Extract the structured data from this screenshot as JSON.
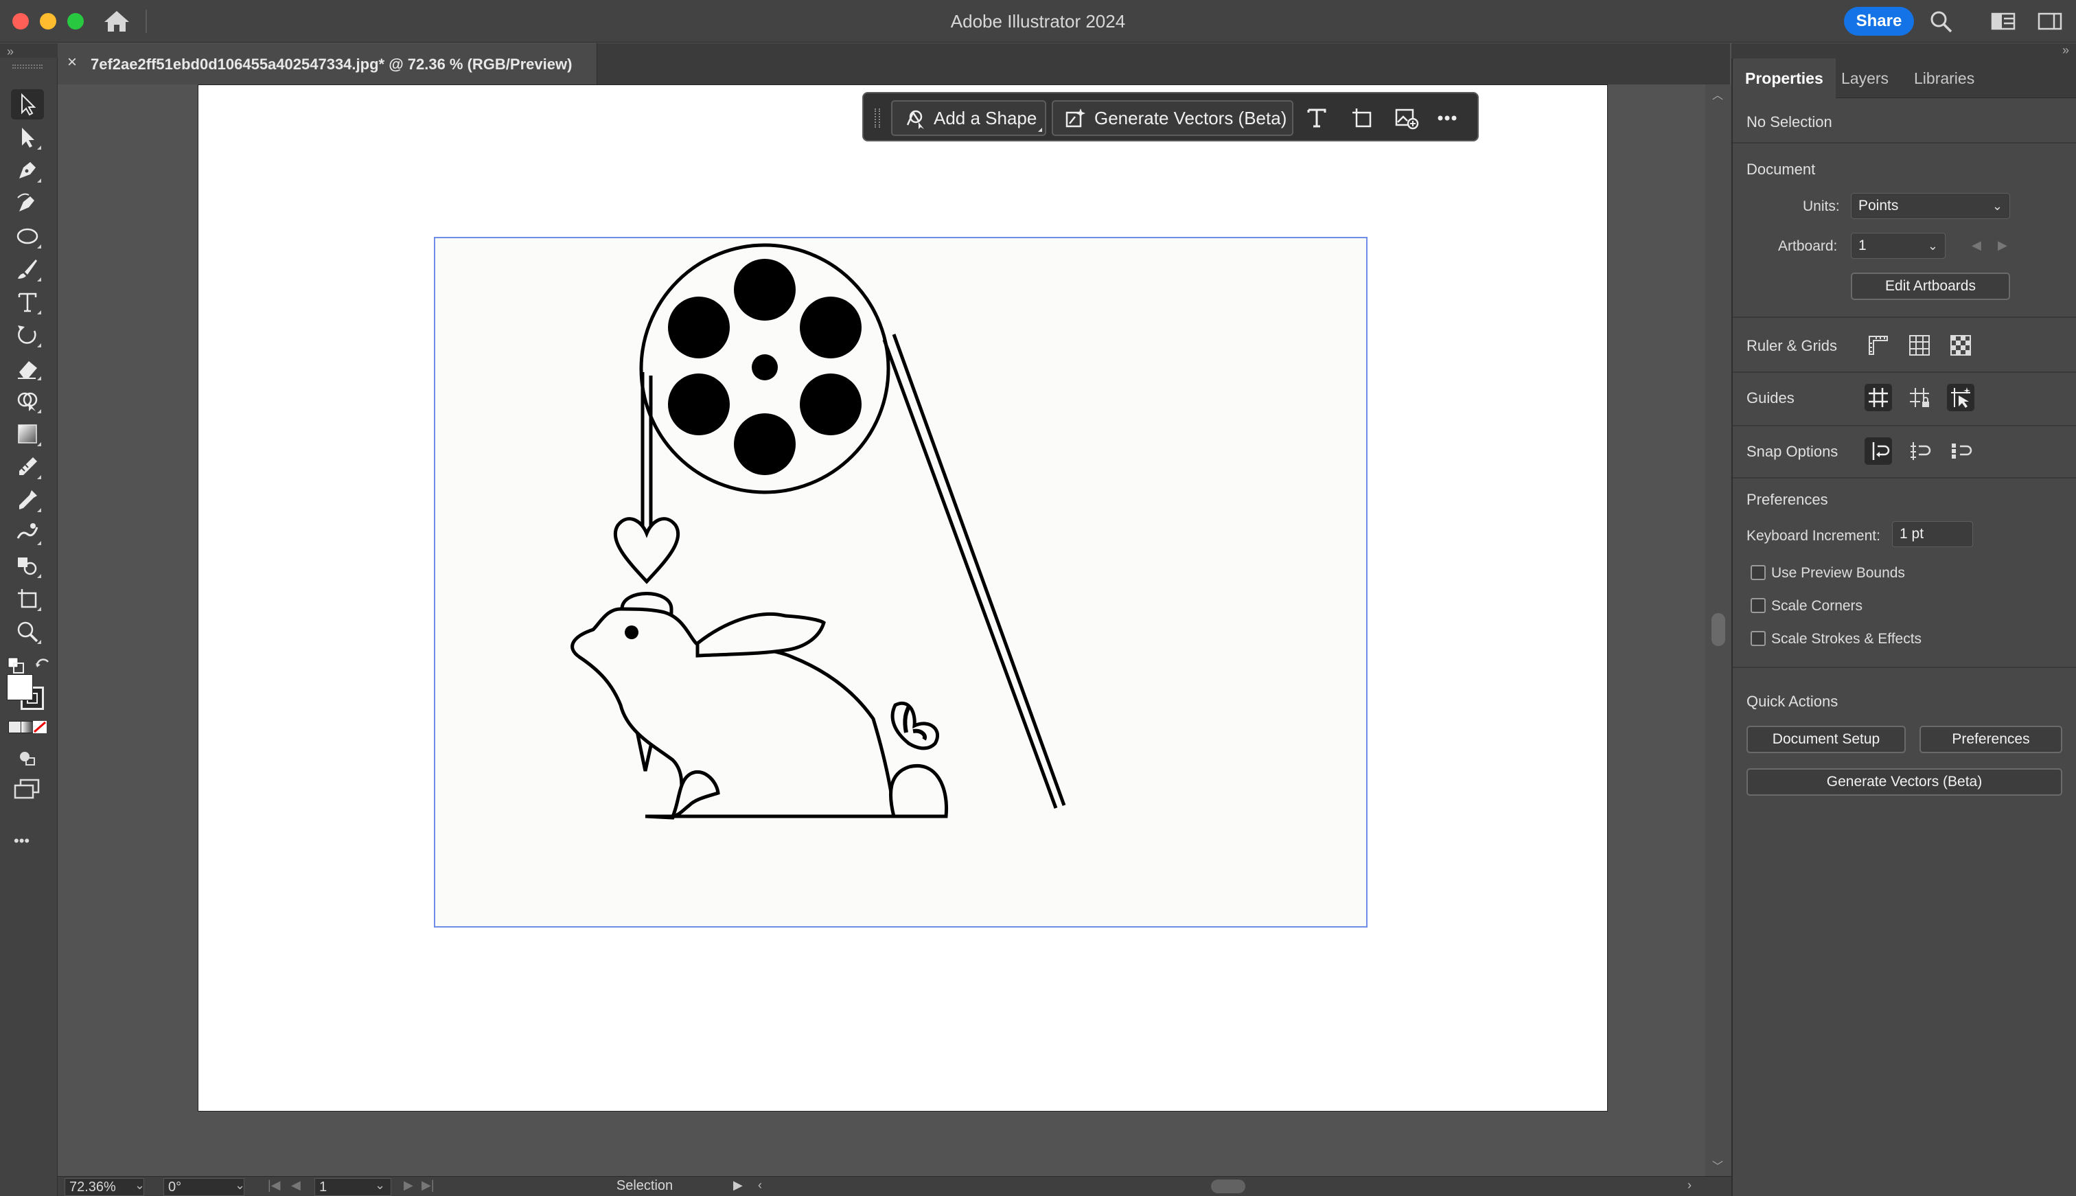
{
  "app": {
    "title": "Adobe Illustrator 2024",
    "share_label": "Share"
  },
  "document": {
    "tab_label": "7ef2ae2ff51ebd0d106455a402547334.jpg* @ 72.36 % (RGB/Preview)",
    "close_glyph": "×"
  },
  "taskbar": {
    "add_shape": "Add a Shape",
    "generate_vectors": "Generate Vectors (Beta)"
  },
  "toolbar": {
    "tools": [
      "selection-tool",
      "direct-selection-tool",
      "pen-tool",
      "curvature-tool",
      "ellipse-tool",
      "paintbrush-tool",
      "type-tool",
      "rotate-tool",
      "eraser-tool",
      "shape-builder-tool",
      "gradient-tool",
      "eyedropper-tool",
      "color-picker-tool",
      "puppet-warp-tool",
      "symbol-sprayer-tool",
      "artboard-tool",
      "zoom-tool"
    ],
    "more_glyph": "•••"
  },
  "statusbar": {
    "zoom": "72.36%",
    "rotation": "0°",
    "artboard": "1",
    "mode": "Selection"
  },
  "panel": {
    "tabs": [
      {
        "label": "Properties"
      },
      {
        "label": "Layers"
      },
      {
        "label": "Libraries"
      }
    ],
    "no_selection": "No Selection",
    "document_heading": "Document",
    "units_label": "Units:",
    "units_value": "Points",
    "artboard_label": "Artboard:",
    "artboard_value": "1",
    "edit_artboards": "Edit Artboards",
    "ruler_grids": "Ruler & Grids",
    "guides": "Guides",
    "snap_options": "Snap Options",
    "preferences_heading": "Preferences",
    "keyboard_increment_label": "Keyboard Increment:",
    "keyboard_increment_value": "1 pt",
    "use_preview_bounds": "Use Preview Bounds",
    "scale_corners": "Scale Corners",
    "scale_strokes": "Scale Strokes & Effects",
    "quick_actions": "Quick Actions",
    "document_setup": "Document Setup",
    "preferences_btn": "Preferences",
    "generate_vectors_btn": "Generate Vectors (Beta)"
  },
  "colors": {
    "accent": "#1473e6",
    "artboard_border": "#6f8ce8"
  }
}
